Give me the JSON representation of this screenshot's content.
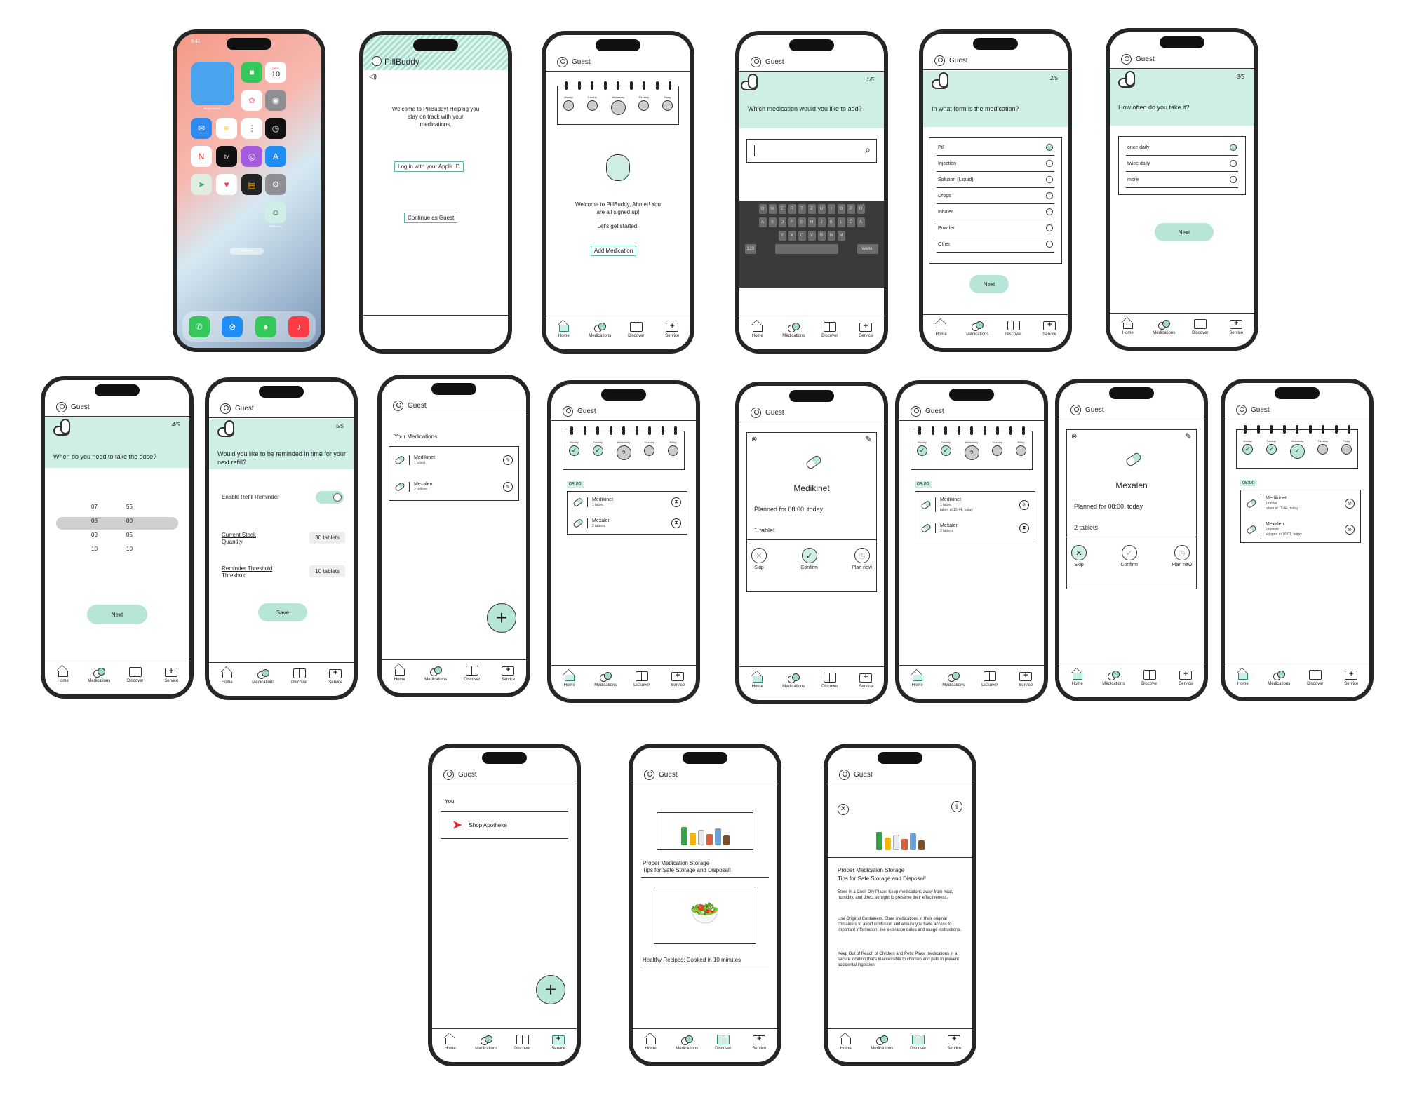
{
  "common": {
    "guest": "Guest",
    "nav": {
      "home": "Home",
      "medications": "Medications",
      "discover": "Discover",
      "service": "Service"
    },
    "next": "Next"
  },
  "home_screen": {
    "time": "9:41",
    "widget_name": "Widget Name",
    "calendar_day": "MON",
    "calendar_date": "10",
    "apps": [
      "FaceTime",
      "Calendar",
      "Photos",
      "Camera",
      "Mail",
      "Notes",
      "Reminders",
      "Clock",
      "News",
      "TV",
      "Podcasts",
      "App Store",
      "Maps",
      "Health",
      "Wallet",
      "Settings",
      "PillBuddy"
    ],
    "search": "Search"
  },
  "welcome": {
    "app_title": "PillBuddy",
    "message": "Welcome to PillBuddy! Helping you stay on track with your medications.",
    "apple_login": "Log in with your Apple ID",
    "guest_login": "Continue as Guest"
  },
  "signed_up": {
    "message": "Welcome to PillBuddy, Ahmet! You are all signed up!",
    "cta": "Let's get started!",
    "add_button": "Add Medication"
  },
  "step1": {
    "step": "1/5",
    "question": "Which medication would you like to add?",
    "keyboard_rows": [
      "QWERTZUIOPÜ",
      "ASDFGHJKLÖÄ",
      "YXCVBNM"
    ],
    "kb_123": "123",
    "kb_return": "Weiter"
  },
  "step2": {
    "step": "2/5",
    "question": "In what form is the medication?",
    "options": [
      "Pill",
      "Injection",
      "Solution (Liquid)",
      "Drops",
      "Inhaler",
      "Powder",
      "Other"
    ]
  },
  "step3": {
    "step": "3/5",
    "question": "How often do you take it?",
    "options": [
      "once daily",
      "twice daily",
      "more"
    ]
  },
  "step4": {
    "step": "4/5",
    "question": "When do you need to take the dose?",
    "hours": [
      "07",
      "08",
      "09",
      "10"
    ],
    "minutes": [
      "55",
      "00",
      "05",
      "10"
    ]
  },
  "step5": {
    "step": "5/5",
    "question": "Would you like to be reminded in time for your next refill?",
    "toggle_label": "Enable Refill Reminder",
    "stock_label": "Current Stock",
    "stock_sub": "Quantity",
    "stock_value": "30 tablets",
    "threshold_label": "Reminder Threshold",
    "threshold_sub": "Threshold",
    "threshold_value": "10 tablets",
    "save": "Save"
  },
  "your_meds": {
    "title": "Your Medications",
    "meds": [
      {
        "name": "Medikinet",
        "dose": "1 tablet"
      },
      {
        "name": "Mexalen",
        "dose": "2 tablets"
      }
    ]
  },
  "calendar": {
    "days": [
      "Monday",
      "Tuesday",
      "Wednesday",
      "Thursday",
      "Friday"
    ],
    "time": "08:00",
    "meds_a": [
      {
        "name": "Medikinet",
        "dose": "1 tablet"
      },
      {
        "name": "Mexalen",
        "dose": "2 tablets"
      }
    ],
    "meds_b": [
      {
        "name": "Medikinet",
        "dose": "1 tablet",
        "note": "taken at 15:44, today"
      },
      {
        "name": "Mexalen",
        "dose": "2 tablets"
      }
    ],
    "meds_c": [
      {
        "name": "Medikinet",
        "dose": "1 tablet",
        "note": "taken at 15:44, today"
      },
      {
        "name": "Mexalen",
        "dose": "2 tablets",
        "note": "skipped at 16:01, today"
      }
    ]
  },
  "detail_medikinet": {
    "name": "Medikinet",
    "planned": "Planned for 08:00, today",
    "amount": "1 tablet",
    "skip": "Skip",
    "confirm": "Confirm",
    "plan_new": "Plan new"
  },
  "detail_mexalen": {
    "name": "Mexalen",
    "planned": "Planned for 08:00, today",
    "amount": "2 tablets",
    "skip": "Skip",
    "confirm": "Confirm",
    "plan_new": "Plan new"
  },
  "service": {
    "section": "You",
    "shop": "Shop Apotheke"
  },
  "discover": {
    "article1_title": "Proper Medication Storage",
    "article1_sub": "Tips for Safe Storage and Disposal!",
    "article2_title": "Healthy Recipes: Cooked in 10 minutes"
  },
  "article": {
    "title": "Proper Medication Storage",
    "subtitle": "Tips for Safe Storage and Disposal!",
    "p1": "Store in a Cool, Dry Place: Keep medications away from heat, humidity, and direct sunlight to preserve their effectiveness.",
    "p2": "Use Original Containers: Store medications in their original containers to avoid confusion and ensure you have access to important information, like expiration dates and usage instructions.",
    "p3": "Keep Out of Reach of Children and Pets: Place medications in a secure location that's inaccessible to children and pets to prevent accidental ingestion."
  },
  "colors": {
    "mint": "#cfeee5",
    "accent": "#b7e6d8",
    "frame": "#262626"
  }
}
